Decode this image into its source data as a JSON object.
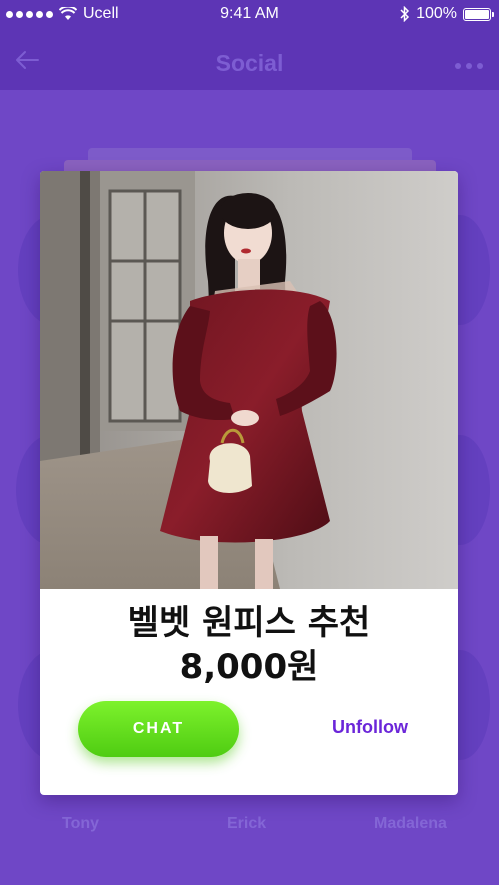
{
  "status_bar": {
    "carrier": "Ucell",
    "time": "9:41 AM",
    "battery": "100%"
  },
  "header": {
    "title": "Social",
    "back_icon": "arrow-left-icon",
    "more_icon": "more-horizontal-icon"
  },
  "card": {
    "title": "벨벳 원피스 추천",
    "price": "8,000원",
    "chat_label": "CHAT",
    "unfollow_label": "Unfollow"
  },
  "background_users": [
    {
      "name": "Tony"
    },
    {
      "name": "Erick"
    },
    {
      "name": "Madalena"
    }
  ],
  "colors": {
    "background": "#6f47c6",
    "header": "#5d35b5",
    "chat_button": "#62e01d",
    "unfollow_text": "#6b26d9"
  }
}
